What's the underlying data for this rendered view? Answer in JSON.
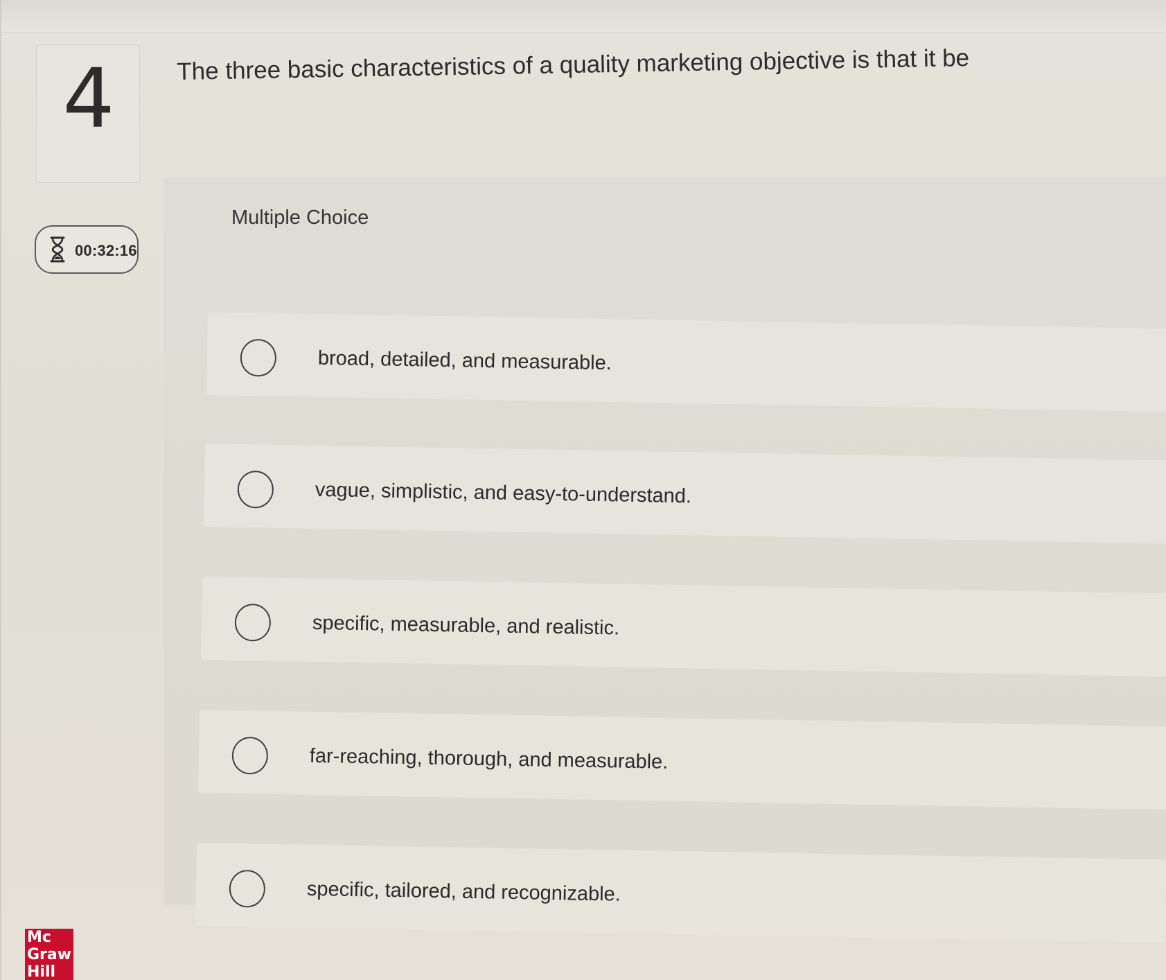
{
  "question": {
    "number": "4",
    "prompt": "The three basic characteristics of a quality marketing objective is that it be",
    "type_label": "Multiple Choice"
  },
  "timer": {
    "icon": "hourglass-icon",
    "value": "00:32:16"
  },
  "options": [
    {
      "label": "broad, detailed, and measurable.",
      "selected": false
    },
    {
      "label": "vague, simplistic, and easy-to-understand.",
      "selected": false
    },
    {
      "label": "specific, measurable, and realistic.",
      "selected": false
    },
    {
      "label": "far-reaching, thorough, and measurable.",
      "selected": false
    },
    {
      "label": "specific, tailored, and recognizable.",
      "selected": false
    }
  ],
  "brand": {
    "logo_text": [
      "Mc",
      "Graw",
      "Hill"
    ],
    "color": "#c8102e"
  }
}
